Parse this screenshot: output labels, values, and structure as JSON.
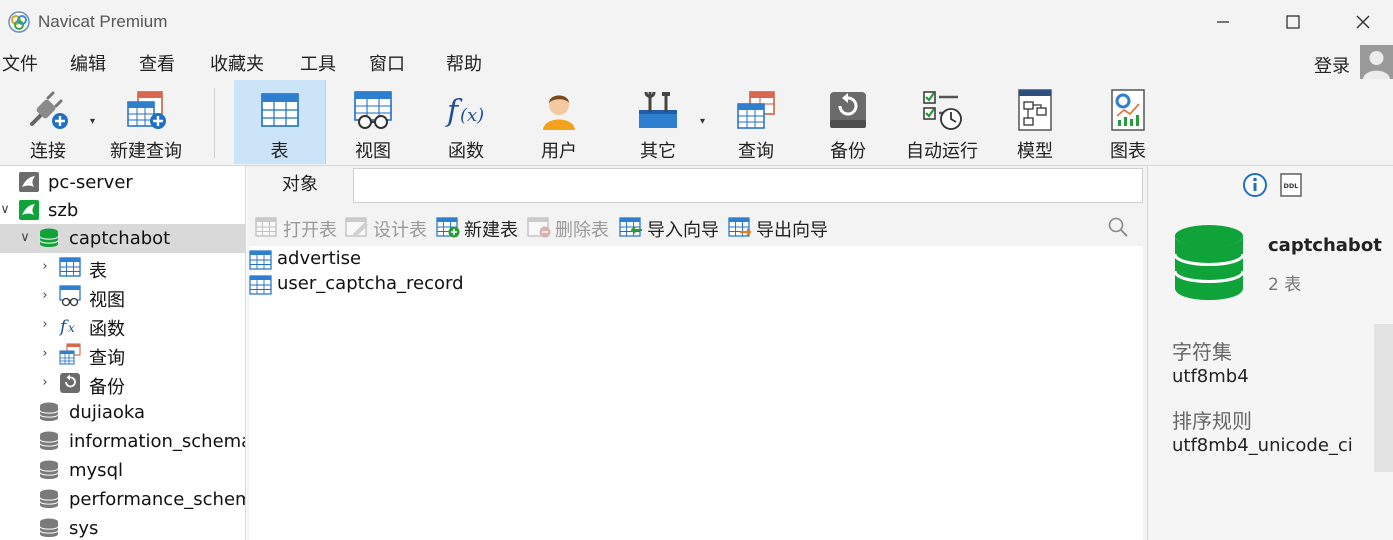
{
  "window": {
    "title": "Navicat Premium"
  },
  "menu": {
    "items": [
      "文件",
      "编辑",
      "查看",
      "收藏夹",
      "工具",
      "窗口",
      "帮助"
    ],
    "login": "登录"
  },
  "toolbar": {
    "items": [
      {
        "label": "连接",
        "icon": "plug-icon"
      },
      {
        "label": "新建查询",
        "icon": "new-query-icon"
      },
      {
        "label": "表",
        "icon": "table-icon"
      },
      {
        "label": "视图",
        "icon": "view-icon"
      },
      {
        "label": "函数",
        "icon": "function-icon"
      },
      {
        "label": "用户",
        "icon": "user-icon"
      },
      {
        "label": "其它",
        "icon": "tools-icon"
      },
      {
        "label": "查询",
        "icon": "query-icon"
      },
      {
        "label": "备份",
        "icon": "backup-icon"
      },
      {
        "label": "自动运行",
        "icon": "schedule-icon"
      },
      {
        "label": "模型",
        "icon": "model-icon"
      },
      {
        "label": "图表",
        "icon": "chart-icon"
      }
    ],
    "active": "表"
  },
  "nav": {
    "connections": [
      {
        "name": "pc-server",
        "expanded": false
      },
      {
        "name": "szb",
        "expanded": true
      }
    ],
    "selected_db": "captchabot",
    "children": [
      "表",
      "视图",
      "函数",
      "查询",
      "备份"
    ],
    "other_dbs": [
      "dujiaoka",
      "information_schema",
      "mysql",
      "performance_schema",
      "sys"
    ]
  },
  "center": {
    "tab_label": "对象",
    "search_placeholder": "",
    "actions": [
      {
        "label": "打开表",
        "enabled": false
      },
      {
        "label": "设计表",
        "enabled": false
      },
      {
        "label": "新建表",
        "enabled": true
      },
      {
        "label": "删除表",
        "enabled": false
      },
      {
        "label": "导入向导",
        "enabled": true
      },
      {
        "label": "导出向导",
        "enabled": true
      }
    ],
    "objects": [
      "advertise",
      "user_captcha_record"
    ]
  },
  "info": {
    "db_name": "captchabot",
    "table_count": "2 表",
    "charset_label": "字符集",
    "charset_value": "utf8mb4",
    "collation_label": "排序规则",
    "collation_value": "utf8mb4_unicode_ci"
  },
  "colors": {
    "accent_blue": "#1f6fc5",
    "db_green": "#0fa33a",
    "active_tab": "#cce4f7"
  }
}
